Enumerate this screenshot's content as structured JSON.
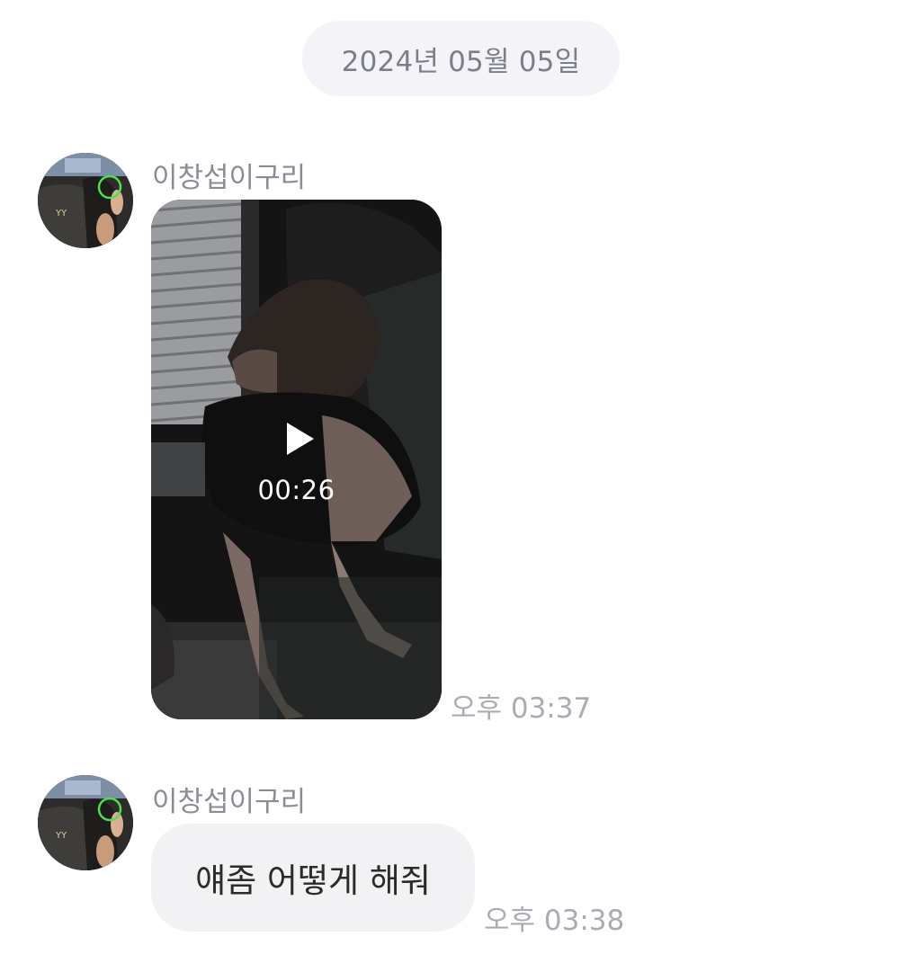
{
  "date_separator": "2024년 05월 05일",
  "messages": [
    {
      "sender": "이창섭이구리",
      "type": "video",
      "avatar_icon": "profile-photo",
      "video": {
        "duration": "00:26",
        "play_icon": "play-icon"
      },
      "time": "오후 03:37"
    },
    {
      "sender": "이창섭이구리",
      "type": "text",
      "avatar_icon": "profile-photo",
      "text": "얘좀 어떻게 해줘",
      "time": "오후 03:38"
    }
  ],
  "colors": {
    "date_pill_bg": "#f4f4f8",
    "bubble_bg": "#f2f2f5",
    "meta_text": "#a9acb3"
  }
}
